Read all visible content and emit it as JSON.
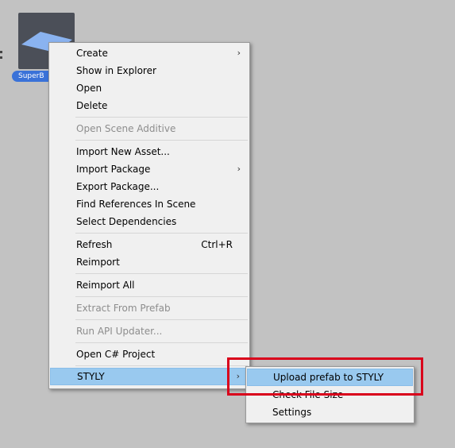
{
  "asset": {
    "label": "SuperB",
    "thumbnail_icon": "plane-mesh-icon"
  },
  "context_menu": {
    "items": [
      {
        "label": "Create",
        "submenu": true
      },
      {
        "label": "Show in Explorer"
      },
      {
        "label": "Open"
      },
      {
        "label": "Delete"
      },
      {
        "label": "Open Scene Additive",
        "disabled": true
      },
      {
        "label": "Import New Asset..."
      },
      {
        "label": "Import Package",
        "submenu": true
      },
      {
        "label": "Export Package..."
      },
      {
        "label": "Find References In Scene"
      },
      {
        "label": "Select Dependencies"
      },
      {
        "label": "Refresh",
        "shortcut": "Ctrl+R"
      },
      {
        "label": "Reimport"
      },
      {
        "label": "Reimport All"
      },
      {
        "label": "Extract From Prefab",
        "disabled": true
      },
      {
        "label": "Run API Updater...",
        "disabled": true
      },
      {
        "label": "Open C# Project"
      },
      {
        "label": "STYLY",
        "submenu": true,
        "highlighted": true
      }
    ],
    "arrow_glyph": "›"
  },
  "styly_submenu": {
    "items": [
      {
        "label": "Upload prefab to STYLY",
        "highlighted": true
      },
      {
        "label": "Check File Size"
      },
      {
        "label": "Settings"
      }
    ]
  },
  "annotation": {
    "color": "#d9001b"
  }
}
